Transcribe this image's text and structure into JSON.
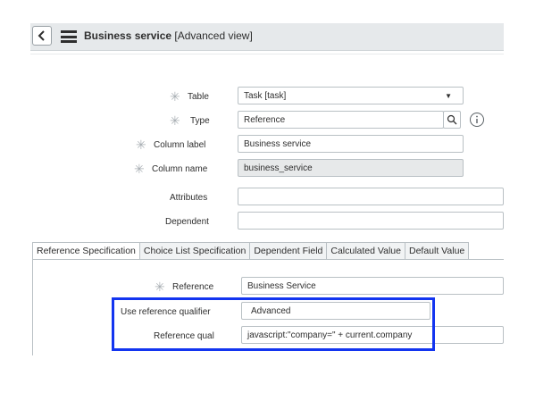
{
  "header": {
    "title_bold": "Business service",
    "title_suffix": "[Advanced view]"
  },
  "form": {
    "table": {
      "label": "Table",
      "value": "Task [task]"
    },
    "type": {
      "label": "Type",
      "value": "Reference"
    },
    "column_label": {
      "label": "Column label",
      "value": "Business service"
    },
    "column_name": {
      "label": "Column name",
      "value": "business_service"
    },
    "attributes": {
      "label": "Attributes",
      "value": ""
    },
    "dependent": {
      "label": "Dependent",
      "value": ""
    }
  },
  "tabs": [
    {
      "label": "Reference Specification"
    },
    {
      "label": "Choice List Specification"
    },
    {
      "label": "Dependent Field"
    },
    {
      "label": "Calculated Value"
    },
    {
      "label": "Default Value"
    }
  ],
  "ref_spec": {
    "reference": {
      "label": "Reference",
      "value": "Business Service"
    },
    "use_qualifier": {
      "label": "Use reference qualifier",
      "value": "Advanced"
    },
    "reference_qual": {
      "label": "Reference qual",
      "value": "javascript:\"company=\" + current.company"
    }
  },
  "colors": {
    "highlight": "#1335f0",
    "header_bg": "#e6e9eb",
    "readonly_bg": "#e7e9ea"
  }
}
